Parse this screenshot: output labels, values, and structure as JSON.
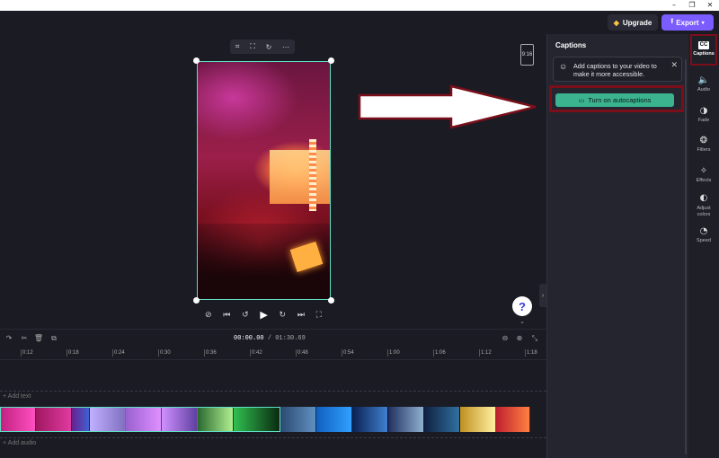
{
  "window": {
    "minimize": "–",
    "maximize": "❐",
    "close": "✕"
  },
  "topbar": {
    "upgrade_label": "Upgrade",
    "export_label": "Export"
  },
  "preview": {
    "aspect_ratio": "9:16",
    "mini_toolbar": [
      "⌗",
      "⛶",
      "↻",
      "⋯"
    ]
  },
  "playback": {
    "current": "00:00.00",
    "total": "/ 01:30.69"
  },
  "timeline": {
    "ticks": [
      "0:12",
      "0:18",
      "0:24",
      "0:30",
      "0:36",
      "0:42",
      "0:48",
      "0:54",
      "1:00",
      "1:06",
      "1:12",
      "1:18"
    ],
    "add_text": "+ Add text",
    "add_audio": "+ Add audio"
  },
  "captions_panel": {
    "title": "Captions",
    "tip_text": "Add captions to your video to make it more accessible.",
    "autocaptions_label": "Turn on autocaptions"
  },
  "rail": [
    {
      "label": "Captions",
      "icon": "cc-icon"
    },
    {
      "label": "Audio",
      "icon": "speaker-icon"
    },
    {
      "label": "Fade",
      "icon": "fade-icon"
    },
    {
      "label": "Filters",
      "icon": "filters-icon"
    },
    {
      "label": "Effects",
      "icon": "effects-icon"
    },
    {
      "label": "Adjust colors",
      "icon": "adjust-icon"
    },
    {
      "label": "Speed",
      "icon": "speed-icon"
    }
  ],
  "colors": {
    "accent": "#7b5cff",
    "autocaptions": "#3bb38e",
    "selection": "#5fe0c4",
    "annotation": "#7a0f1a"
  }
}
